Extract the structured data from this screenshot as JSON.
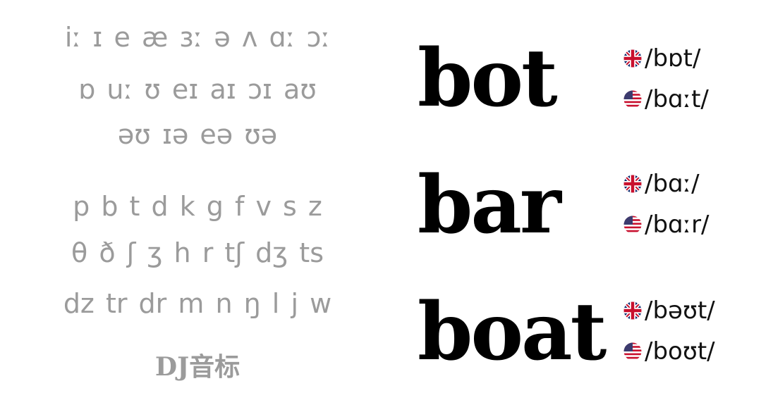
{
  "phonetics": {
    "vowel_lines": [
      "iː ɪ e æ ɜː ə ʌ ɑː ɔː",
      "ɒ uː ʊ eɪ aɪ ɔɪ aʊ",
      "əʊ ɪə eə ʊə"
    ],
    "consonant_lines": [
      "p b t d k g f v s z",
      "θ ð ʃ ʒ h r tʃ dʒ ts",
      "dz tr dr m n ŋ l j w"
    ],
    "caption": "DJ音标"
  },
  "words": [
    {
      "word": "bot",
      "uk": "/bɒt/",
      "us": "/bɑːt/"
    },
    {
      "word": "bar",
      "uk": "/bɑː/",
      "us": "/bɑːr/"
    },
    {
      "word": "boat",
      "uk": "/bəʊt/",
      "us": "/boʊt/"
    }
  ],
  "flags": {
    "uk": "uk-flag-icon",
    "us": "us-flag-icon"
  },
  "colors": {
    "phonetic_gray": "#9b9b9b",
    "word_black": "#000000",
    "uk_blue": "#012169",
    "red": "#c8102e",
    "us_blue": "#3c3b6e"
  }
}
